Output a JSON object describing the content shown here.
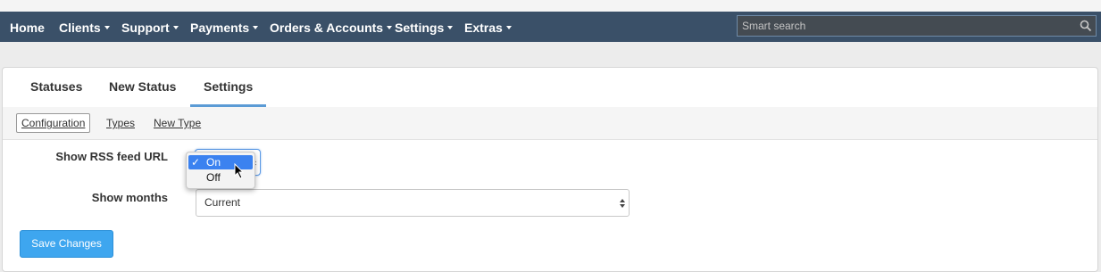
{
  "navbar": {
    "items": [
      {
        "label": "Home",
        "dropdown": false
      },
      {
        "label": "Clients",
        "dropdown": true
      },
      {
        "label": "Support",
        "dropdown": true
      },
      {
        "label": "Payments",
        "dropdown": true
      },
      {
        "label": "Orders & Accounts",
        "dropdown": true
      },
      {
        "label": "Settings",
        "dropdown": true
      },
      {
        "label": "Extras",
        "dropdown": true
      }
    ],
    "search": {
      "placeholder": "Smart search",
      "value": ""
    }
  },
  "tabs": {
    "statuses": "Statuses",
    "new_status": "New Status",
    "settings": "Settings",
    "active": "Settings"
  },
  "subnav": {
    "configuration": "Configuration",
    "types": "Types",
    "new_type": "New Type",
    "active": "Configuration"
  },
  "form": {
    "rss_label": "Show RSS feed URL",
    "rss_options": [
      {
        "label": "On",
        "selected": true
      },
      {
        "label": "Off",
        "selected": false
      }
    ],
    "rss_check": "✓",
    "months_label": "Show months",
    "months_value": "Current",
    "save_label": "Save Changes"
  },
  "colors": {
    "navbar": "#3a5068",
    "accent": "#5b9bd5",
    "button": "#3ea6ef",
    "selection": "#3b82f0"
  },
  "icons": {
    "search": "search-icon",
    "cursor": "mouse-pointer-icon"
  }
}
